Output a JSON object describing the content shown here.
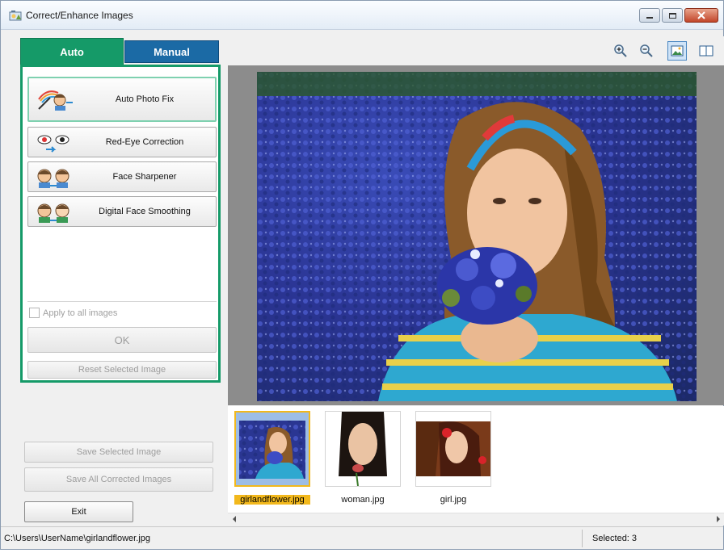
{
  "window": {
    "title": "Correct/Enhance Images"
  },
  "tabs": [
    {
      "label": "Auto",
      "active": true,
      "color": "#159a68"
    },
    {
      "label": "Manual",
      "active": false,
      "color": "#1b6aa5"
    }
  ],
  "fix_buttons": [
    {
      "label": "Auto Photo Fix",
      "icon": "auto-photo-fix-icon",
      "selected": true
    },
    {
      "label": "Red-Eye Correction",
      "icon": "red-eye-icon"
    },
    {
      "label": "Face Sharpener",
      "icon": "face-sharpener-icon"
    },
    {
      "label": "Digital Face Smoothing",
      "icon": "face-smoothing-icon"
    }
  ],
  "apply_all": {
    "label": "Apply to all images",
    "checked": false
  },
  "ok_label": "OK",
  "reset_label": "Reset Selected Image",
  "save_selected_label": "Save Selected Image",
  "save_all_label": "Save All Corrected Images",
  "exit_label": "Exit",
  "toolbar": {
    "zoom_in": "zoom-in-icon",
    "zoom_out": "zoom-out-icon",
    "whole_image": "whole-image-icon",
    "compare": "compare-icon"
  },
  "thumbnails": [
    {
      "name": "girlandflower.jpg",
      "selected": true
    },
    {
      "name": "woman.jpg",
      "selected": false
    },
    {
      "name": "girl.jpg",
      "selected": false
    }
  ],
  "status": {
    "path": "C:\\Users\\UserName\\girlandflower.jpg",
    "selected": "Selected: 3"
  }
}
